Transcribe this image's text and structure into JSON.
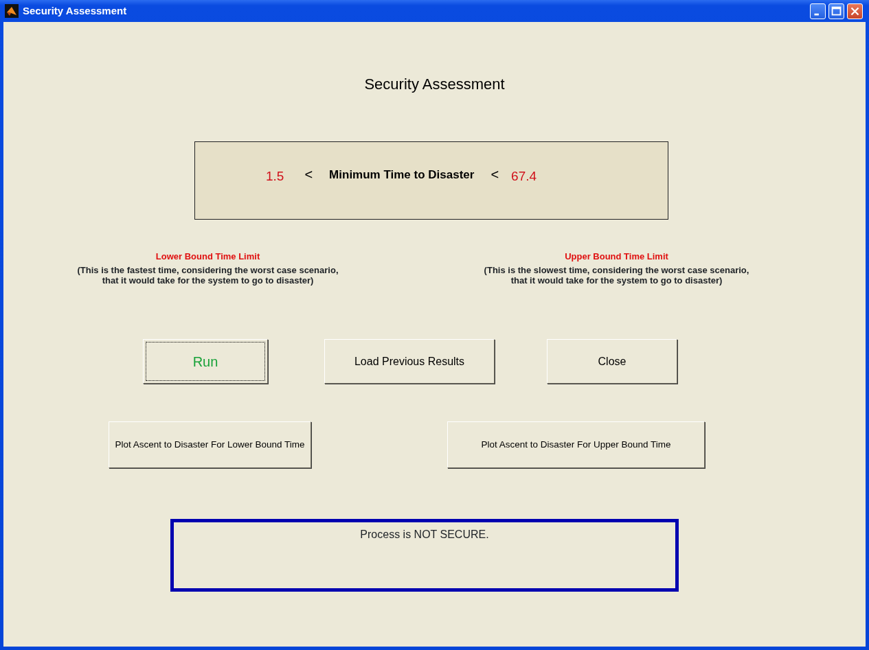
{
  "window": {
    "title": "Security Assessment"
  },
  "heading": "Security Assessment",
  "range": {
    "lower": "1.5",
    "symbol_left": "<",
    "label": "Minimum Time to Disaster",
    "symbol_right": "<",
    "upper": "67.4"
  },
  "bounds": [
    {
      "title": "Lower Bound Time Limit",
      "description_lines": [
        "(This is the fastest time, considering the worst case scenario,",
        "that it would take for the system to go to disaster)"
      ]
    },
    {
      "title": "Upper Bound Time Limit",
      "description_lines": [
        "(This is the slowest time, considering the worst case scenario,",
        "that it would take for the system to go to disaster)"
      ]
    }
  ],
  "buttons": [
    {
      "label": "Run",
      "kind": "run",
      "focused": true
    },
    {
      "label": "Load Previous Results",
      "kind": "normal",
      "focused": false
    },
    {
      "label": "Close",
      "kind": "normal",
      "focused": false
    }
  ],
  "plot_buttons": [
    {
      "label": "Plot Ascent to Disaster For Lower Bound Time"
    },
    {
      "label": "Plot Ascent to Disaster For Upper Bound Time"
    }
  ],
  "status": {
    "text": "Process is NOT SECURE."
  }
}
